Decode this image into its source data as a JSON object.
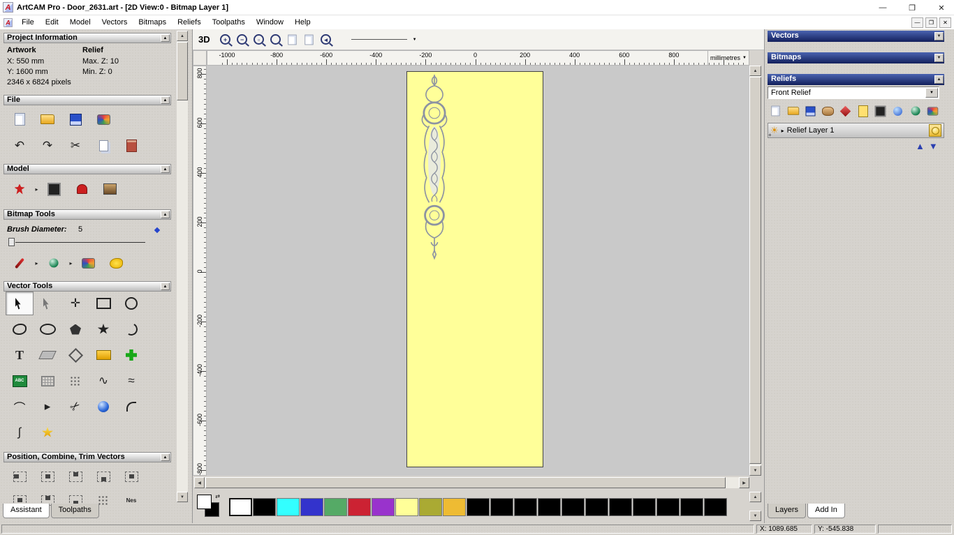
{
  "window": {
    "title": "ArtCAM Pro - Door_2631.art - [2D View:0 - Bitmap Layer 1]",
    "minimize": "—",
    "maximize": "❐",
    "close": "✕",
    "mdi_minimize": "—",
    "mdi_restore": "❐",
    "mdi_close": "✕"
  },
  "glyphs": {
    "collapse": "▲",
    "dropdown": "▼",
    "up": "▲",
    "down": "▼",
    "left": "◀",
    "right": "▶",
    "flyout": "▸",
    "sun": "☀",
    "plus": "+",
    "swap": "⇄"
  },
  "menu": {
    "items": [
      "File",
      "Edit",
      "Model",
      "Vectors",
      "Bitmaps",
      "Reliefs",
      "Toolpaths",
      "Window",
      "Help"
    ]
  },
  "toolbar": {
    "view_3d": "3D",
    "icons": [
      {
        "n": "zoom-in-icon",
        "c": "mag",
        "g": "+"
      },
      {
        "n": "zoom-out-icon",
        "c": "mag",
        "g": "−"
      },
      {
        "n": "zoom-window-icon",
        "c": "mag",
        "g": "▫"
      },
      {
        "n": "zoom-fit-icon",
        "c": "mag",
        "g": ""
      },
      {
        "n": "previous-view-icon",
        "c": "c-page s",
        "g": ""
      },
      {
        "n": "next-view-icon",
        "c": "c-page s",
        "g": ""
      },
      {
        "n": "zoom-previous-icon",
        "c": "mag",
        "g": "◂"
      }
    ]
  },
  "rulers": {
    "h_ticks": [
      -1000,
      -800,
      -600,
      -400,
      -200,
      0,
      200,
      400,
      600,
      800
    ],
    "v_ticks": [
      800,
      600,
      400,
      200,
      0,
      -200,
      -400,
      -600,
      -800
    ],
    "units": "millimetres"
  },
  "left": {
    "project_info": {
      "title": "Project Information",
      "artwork_label": "Artwork",
      "relief_label": "Relief",
      "x": "X: 550 mm",
      "y": "Y: 1600 mm",
      "max_z": "Max. Z: 10",
      "min_z": "Min. Z: 0",
      "pixels": "2346 x 6824 pixels"
    },
    "file": {
      "title": "File",
      "row1": [
        {
          "n": "new-model-icon",
          "c": "c-page"
        },
        {
          "n": "open-model-icon",
          "c": "c-folder"
        },
        {
          "n": "save-model-icon",
          "c": "c-disk"
        },
        {
          "n": "model-export-icon",
          "c": "c-multi"
        }
      ],
      "row2": [
        {
          "n": "undo-icon",
          "c": "glyph big",
          "g": "↶"
        },
        {
          "n": "redo-icon",
          "c": "glyph big",
          "g": "↷"
        },
        {
          "n": "cut-icon",
          "c": "glyph big",
          "g": "✂"
        },
        {
          "n": "paste-icon",
          "c": "c-pages"
        },
        {
          "n": "notes-icon",
          "c": "c-clip"
        }
      ]
    },
    "model": {
      "title": "Model",
      "row": [
        {
          "n": "set-model-size-icon",
          "c": "c-redfig"
        },
        {
          "c": "flyout",
          "g": "▸"
        },
        {
          "n": "greyscale-preview-icon",
          "c": "c-dark"
        },
        {
          "n": "relief-stamp-icon",
          "c": "c-stamp"
        },
        {
          "n": "load-bitmap-icon",
          "c": "c-pic"
        }
      ]
    },
    "bitmap": {
      "title": "Bitmap Tools",
      "brush_label": "Brush Diameter:",
      "brush_value": "5",
      "row": [
        {
          "n": "paint-tool",
          "c": "c-brush"
        },
        {
          "c": "flyout",
          "g": "▸"
        },
        {
          "n": "draw-tool",
          "c": "c-sphere s teal"
        },
        {
          "c": "flyout",
          "g": "▸"
        },
        {
          "n": "colour-palette-tool",
          "c": "c-multi"
        },
        {
          "n": "flood-fill-tool",
          "c": "c-blob-y"
        }
      ]
    },
    "vector": {
      "title": "Vector Tools",
      "cells": [
        {
          "n": "select-vectors-tool",
          "c": "c-cursor",
          "sel": true
        },
        {
          "n": "node-editing-tool",
          "c": "c-cursor light"
        },
        {
          "n": "transform-vectors-tool",
          "c": "glyph big",
          "g": "✛"
        },
        {
          "n": "create-rectangle-tool",
          "c": "c-rect"
        },
        {
          "n": "create-circle-tool",
          "c": "c-circ"
        },
        {
          "n": "create-freeform-tool",
          "c": "c-blob"
        },
        {
          "n": "create-ellipse-tool",
          "c": "c-ell"
        },
        {
          "n": "create-polygon-tool",
          "c": "c-pent"
        },
        {
          "n": "create-star-tool",
          "c": "c-star"
        },
        {
          "n": "create-arc-tool",
          "c": "c-arc"
        },
        {
          "n": "create-text-tool",
          "c": "glyph tbig",
          "g": "T"
        },
        {
          "n": "shear-tool",
          "c": "c-para"
        },
        {
          "n": "create-diamond-tool",
          "c": "c-diamond"
        },
        {
          "n": "measure-tool",
          "c": "c-measure"
        },
        {
          "n": "block-copy-tool",
          "c": "c-cross"
        },
        {
          "n": "paste-text-block-tool",
          "c": "c-abc",
          "g": "ABC"
        },
        {
          "n": "bitmap-fade-tool",
          "c": "c-grid"
        },
        {
          "n": "paste-along-curve-tool",
          "c": "c-dots"
        },
        {
          "n": "fit-curve-tool",
          "c": "glyph big",
          "g": "∿"
        },
        {
          "n": "smooth-polyline-tool",
          "c": "glyph big",
          "g": "≈"
        },
        {
          "n": "fit-arcs-tool",
          "c": "glyph big",
          "g": "⌒"
        },
        {
          "n": "join-vectors-tool",
          "c": "glyph big",
          "g": "▸"
        },
        {
          "n": "trim-vectors-tool",
          "c": "glyph big rot",
          "g": "✂"
        },
        {
          "n": "create-shape-sphere-tool",
          "c": "c-sphere"
        },
        {
          "n": "fillet-tool",
          "c": "c-fillet"
        },
        {
          "n": "section-profile-tool",
          "c": "glyph big",
          "g": "∫"
        },
        {
          "n": "vector-doctor-tool",
          "c": "c-star gold"
        }
      ]
    },
    "position": {
      "title": "Position, Combine, Trim Vectors",
      "row1": [
        {
          "n": "align-left-icon",
          "c": "c-align al-l"
        },
        {
          "n": "align-centre-icon",
          "c": "c-align al-c"
        },
        {
          "n": "align-top-icon",
          "c": "c-align al-t"
        },
        {
          "n": "align-bottom-icon",
          "c": "c-align al-b"
        },
        {
          "n": "align-middle-icon",
          "c": "c-align al-m"
        }
      ],
      "row2": [
        {
          "n": "align-in-page-icon",
          "c": "c-align al-c"
        },
        {
          "n": "combine-weld-icon",
          "c": "c-align al-t"
        },
        {
          "n": "combine-subtract-icon",
          "c": "c-align al-b"
        },
        {
          "n": "paste-array-icon",
          "c": "c-dots"
        },
        {
          "n": "nesting-tool",
          "c": "glyph tiny",
          "g": "Nes"
        }
      ]
    },
    "tabs": [
      "Assistant",
      "Toolpaths"
    ]
  },
  "palette": {
    "colors": [
      "#ffffff",
      "#000000",
      "#33ffff",
      "#3333cc",
      "#55aa66",
      "#cc2233",
      "#9933cc",
      "#ffff99",
      "#aaaa33",
      "#eebb33",
      "#000000",
      "#000000",
      "#000000",
      "#000000",
      "#000000",
      "#000000",
      "#000000",
      "#000000",
      "#000000",
      "#000000",
      "#000000"
    ]
  },
  "right": {
    "vectors_title": "Vectors",
    "bitmaps_title": "Bitmaps",
    "reliefs_title": "Reliefs",
    "relief_select": "Front Relief",
    "relief_icons": [
      {
        "n": "new-relief-icon",
        "c": "c-page s"
      },
      {
        "n": "load-relief-icon",
        "c": "c-folder s"
      },
      {
        "n": "save-relief-icon",
        "c": "c-disk s"
      },
      {
        "n": "relief-texture-icon",
        "c": "c-clay"
      },
      {
        "n": "relief-shape-icon",
        "c": "c-gem"
      },
      {
        "n": "relief-scale-icon",
        "c": "c-ypage"
      },
      {
        "n": "relief-greyscale-icon",
        "c": "c-dark s"
      },
      {
        "n": "relief-envelope-icon",
        "c": "c-drop"
      },
      {
        "n": "relief-wrap-icon",
        "c": "c-sphere s teal"
      },
      {
        "n": "relief-offset-icon",
        "c": "c-multi s"
      }
    ],
    "layer": {
      "name": "Relief Layer 1"
    },
    "tabs": [
      "Layers",
      "Add In"
    ]
  },
  "status": {
    "x": "X: 1089.685",
    "y": "Y: -545.838"
  },
  "colors": {
    "door_yellow": "#ffff99",
    "header_navy": "#13205c"
  }
}
